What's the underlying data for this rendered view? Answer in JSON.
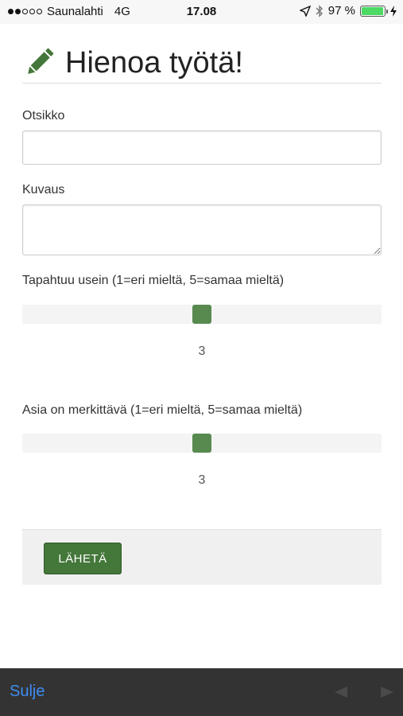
{
  "status_bar": {
    "carrier": "Saunalahti",
    "network": "4G",
    "time": "17.08",
    "battery": "97 %",
    "battery_level": 0.97,
    "icons": [
      "signal-dots-icon",
      "location-icon",
      "bluetooth-icon",
      "battery-icon",
      "charging-icon"
    ]
  },
  "page": {
    "title": "Hienoa työtä!",
    "title_icon": "pencil-icon"
  },
  "form": {
    "otsikko_label": "Otsikko",
    "otsikko_value": "",
    "kuvaus_label": "Kuvaus",
    "kuvaus_value": "",
    "slider1": {
      "label": "Tapahtuu usein (1=eri mieltä, 5=samaa mieltä)",
      "min": 1,
      "max": 5,
      "value": 3,
      "display": "3"
    },
    "slider2": {
      "label": "Asia on merkittävä (1=eri mieltä, 5=samaa mieltä)",
      "min": 1,
      "max": 5,
      "value": 3,
      "display": "3"
    },
    "submit_label": "LÄHETÄ"
  },
  "toolbar": {
    "close_label": "Sulje",
    "icons": [
      "back-arrow-icon",
      "forward-arrow-icon"
    ]
  },
  "colors": {
    "accent": "#44773a",
    "slider_thumb": "#588a50",
    "link": "#3d8cf0",
    "battery": "#4cd964",
    "toolbar_bg": "#333333"
  }
}
